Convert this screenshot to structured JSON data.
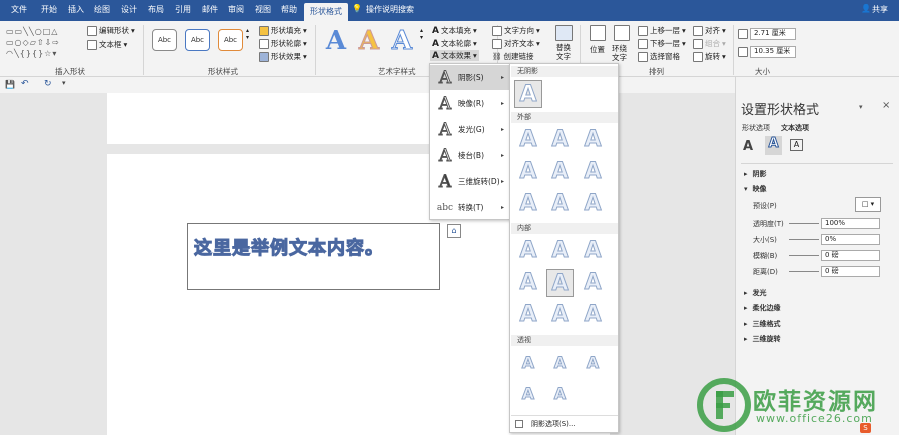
{
  "tabs": [
    "文件",
    "开始",
    "插入",
    "绘图",
    "设计",
    "布局",
    "引用",
    "邮件",
    "审阅",
    "视图",
    "帮助",
    "形状格式",
    "操作说明搜索",
    "共享"
  ],
  "ribbon": {
    "insert_shapes": {
      "edit_shape": "编辑形状",
      "textbox": "文本框",
      "label": "插入形状"
    },
    "shape_styles": {
      "samples": [
        "Abc",
        "Abc",
        "Abc"
      ],
      "fill": "形状填充",
      "outline": "形状轮廓",
      "effects": "形状效果",
      "label": "形状样式"
    },
    "wordart": {
      "letter": "A",
      "text_fill": "文本填充",
      "text_outline": "文本轮廓",
      "text_effects": "文本效果",
      "label": "艺术字样式"
    },
    "text": {
      "direction": "文字方向",
      "align": "对齐文本",
      "link": "创建链接",
      "alt_text": "替换文字"
    },
    "arrange": {
      "position": "位置",
      "wrap": "环绕文字",
      "forward": "上移一层",
      "backward": "下移一层",
      "pane": "选择窗格",
      "align": "对齐",
      "group": "组合",
      "rotate": "旋转",
      "label": "排列"
    },
    "size": {
      "height": "2.71 厘米",
      "width": "10.35 厘米",
      "label": "大小"
    }
  },
  "document": {
    "sample_text": "这里是举例文本内容。"
  },
  "effects_menu": [
    {
      "label": "阴影(S)",
      "glyph": "A"
    },
    {
      "label": "映像(R)",
      "glyph": "A"
    },
    {
      "label": "发光(G)",
      "glyph": "A"
    },
    {
      "label": "棱台(B)",
      "glyph": "A"
    },
    {
      "label": "三维旋转(D)",
      "glyph": "A"
    },
    {
      "label": "转换(T)",
      "glyph": "abc"
    }
  ],
  "shadow_gallery": {
    "sections": [
      "无阴影",
      "外部",
      "内部",
      "透视"
    ],
    "letter": "A",
    "footer": "阴影选项(S)..."
  },
  "format_pane": {
    "title": "设置形状格式",
    "tab_shape": "形状选项",
    "tab_text": "文本选项",
    "sections": [
      "阴影",
      "映像",
      "发光",
      "柔化边缘",
      "三维格式",
      "三维旋转"
    ],
    "reflection": {
      "preset": "预设(P)",
      "transparency": "透明度(T)",
      "transparency_val": "100%",
      "size": "大小(S)",
      "size_val": "0%",
      "blur": "模糊(B)",
      "blur_val": "0 磅",
      "distance": "距离(D)",
      "distance_val": "0 磅"
    }
  },
  "watermark": {
    "brand": "欧菲资源网",
    "url": "www.office26.com",
    "color": "#3a9d44"
  },
  "colors": {
    "accent": "#2b579a",
    "ribbon_bg": "#f3f3f3"
  }
}
